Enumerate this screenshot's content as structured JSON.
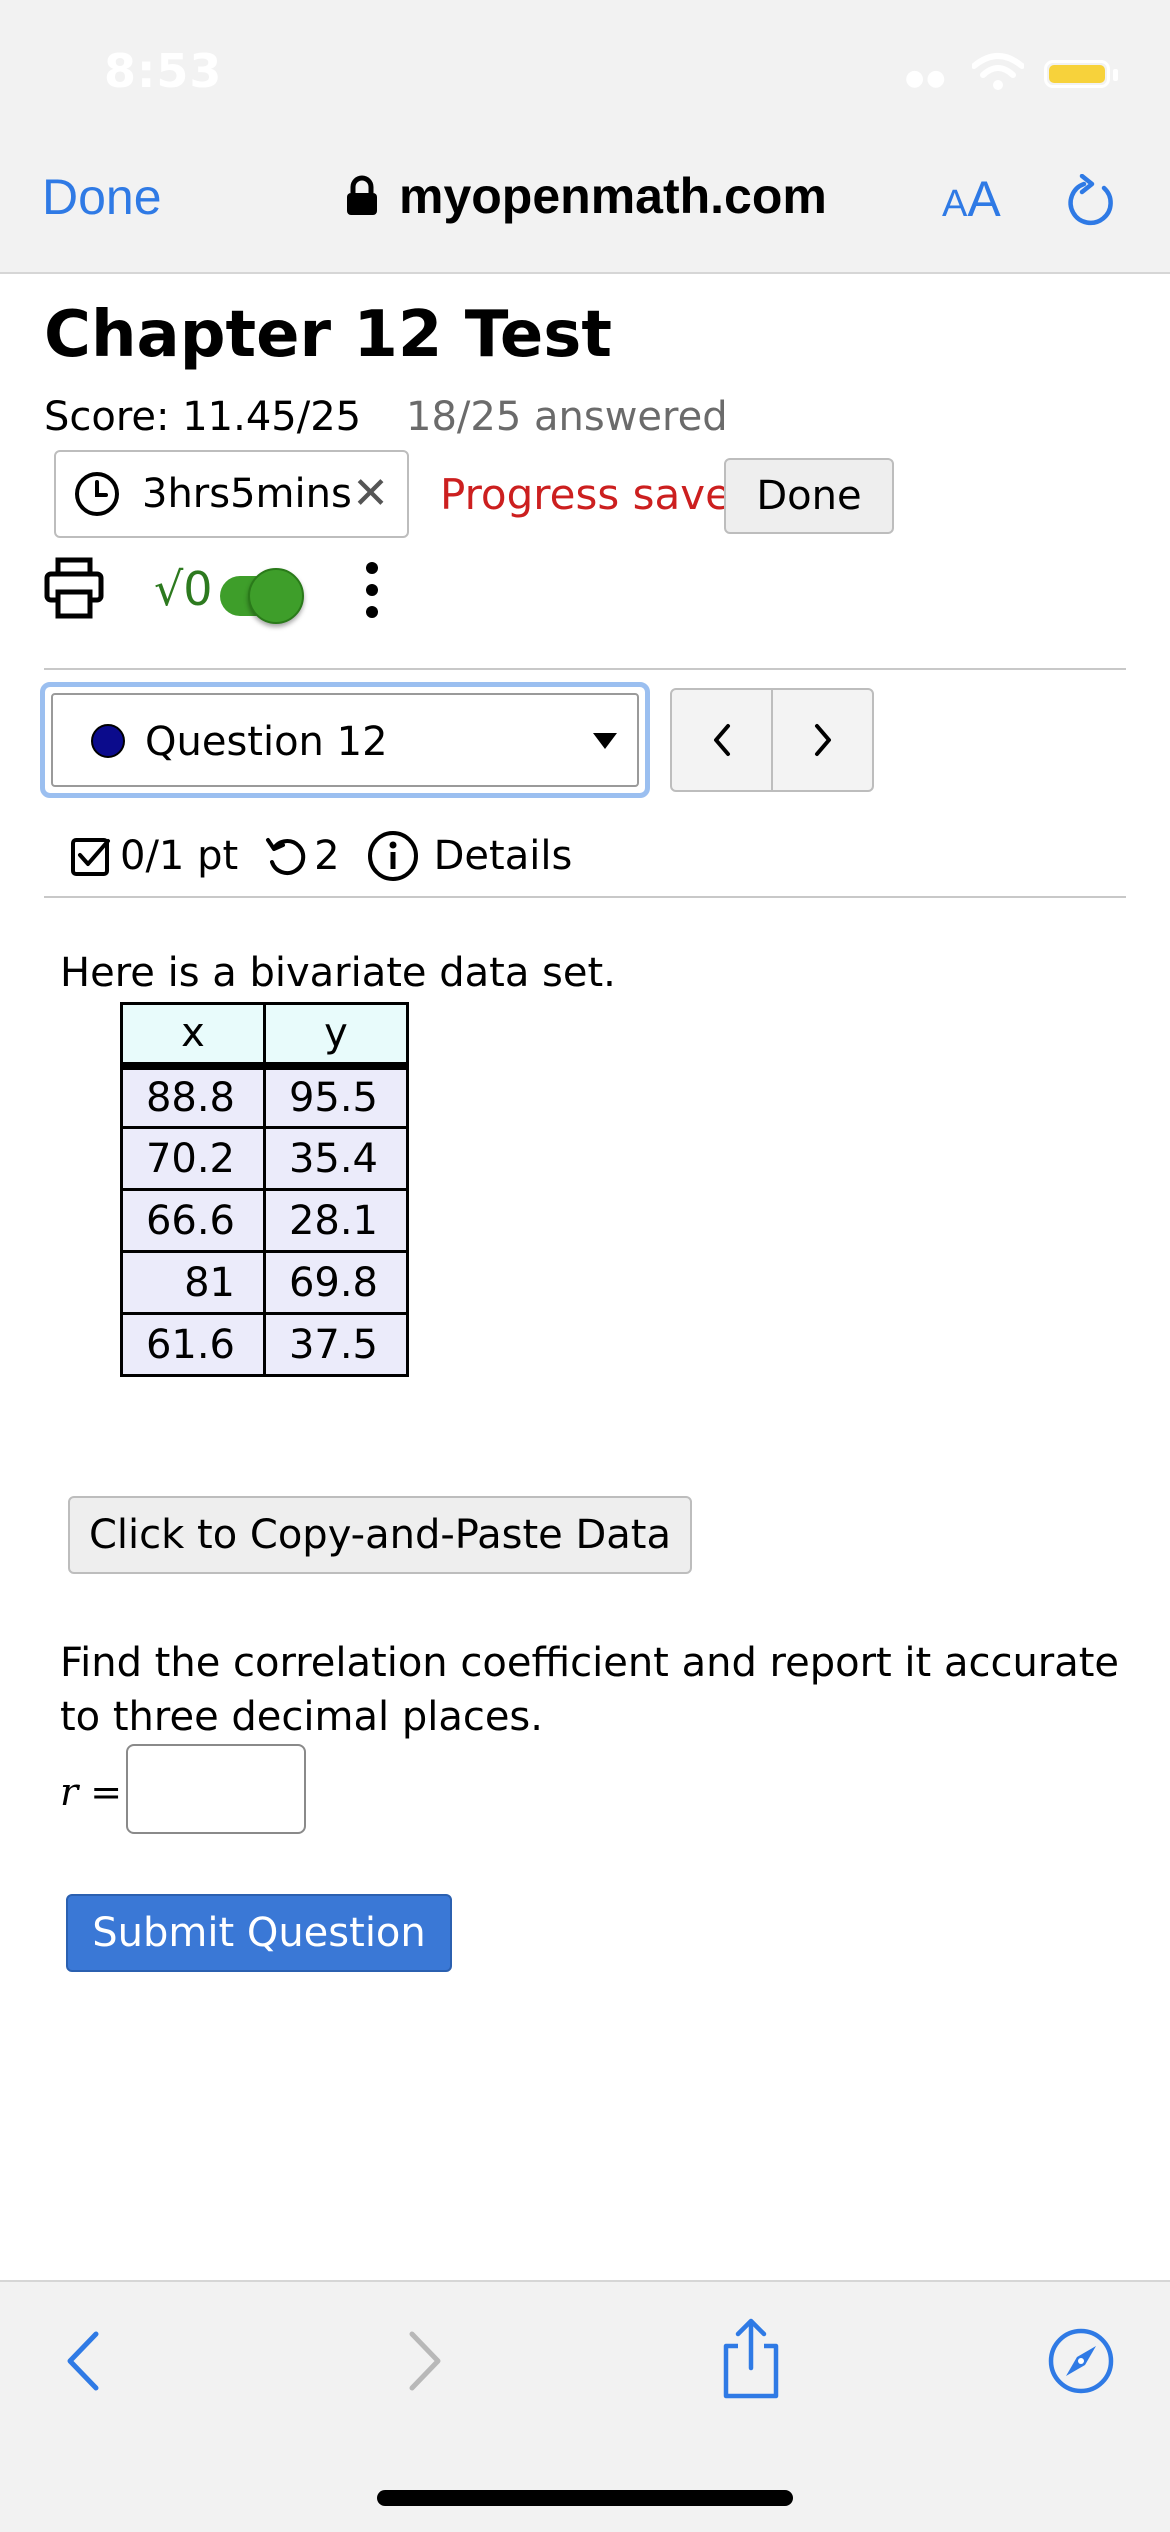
{
  "status_bar": {
    "time": "8:53"
  },
  "browser": {
    "done_label": "Done",
    "url": "myopenmath.com",
    "text_size_small": "A",
    "text_size_large": "A"
  },
  "assessment": {
    "title": "Chapter 12 Test",
    "score": "Score: 11.45/25",
    "answered": "18/25 answered",
    "timer": "3hrs5mins",
    "timer_close": "✕",
    "progress_status": "Progress saved",
    "done_button": "Done",
    "sqrt_symbol": "√0"
  },
  "question_nav": {
    "selected": "Question 12",
    "prev": "‹",
    "next": "›"
  },
  "question_meta": {
    "points": "0/1 pt",
    "attempts": "2",
    "details": "Details"
  },
  "question": {
    "intro": "Here is a bivariate data set.",
    "table": {
      "headers": [
        "x",
        "y"
      ],
      "rows": [
        [
          "88.8",
          "95.5"
        ],
        [
          "70.2",
          "35.4"
        ],
        [
          "66.6",
          "28.1"
        ],
        [
          "81",
          "69.8"
        ],
        [
          "61.6",
          "37.5"
        ]
      ]
    },
    "copy_button": "Click to Copy-and-Paste Data",
    "prompt": "Find the correlation coefficient and report it accurate to three decimal places.",
    "answer_var": "r",
    "answer_eq": "=",
    "answer_value": "",
    "submit_button": "Submit Question"
  },
  "colors": {
    "link_blue": "#2f7ae5",
    "progress_red": "#cc1f1f",
    "submit_blue": "#3a78d6",
    "toggle_green": "#3e9e2a"
  },
  "icons": [
    "wifi-icon",
    "battery-icon",
    "lock-icon",
    "reload-icon",
    "clock-icon",
    "close-icon",
    "print-icon",
    "kebab-menu-icon",
    "checkbox-icon",
    "retry-icon",
    "info-icon",
    "chevron-left-icon",
    "chevron-right-icon",
    "share-icon",
    "compass-icon"
  ]
}
